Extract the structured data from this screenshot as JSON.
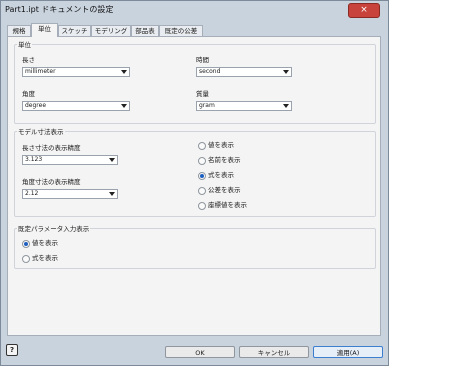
{
  "window": {
    "title": "Part1.ipt ドキュメントの設定",
    "close": "×"
  },
  "tabs": [
    "規格",
    "単位",
    "スケッチ",
    "モデリング",
    "部品表",
    "既定の公差"
  ],
  "units": {
    "legend": "単位",
    "length_label": "長さ",
    "length_value": "millimeter",
    "time_label": "時間",
    "time_value": "second",
    "angle_label": "角度",
    "angle_value": "degree",
    "mass_label": "質量",
    "mass_value": "gram"
  },
  "model_dim": {
    "legend": "モデル寸法表示",
    "linear_precision_label": "長さ寸法の表示精度",
    "linear_precision_value": "3.123",
    "angular_precision_label": "角度寸法の表示精度",
    "angular_precision_value": "2.12",
    "options": [
      {
        "label": "値を表示",
        "checked": false
      },
      {
        "label": "名前を表示",
        "checked": false
      },
      {
        "label": "式を表示",
        "checked": true
      },
      {
        "label": "公差を表示",
        "checked": false
      },
      {
        "label": "座標値を表示",
        "checked": false
      }
    ]
  },
  "param_input": {
    "legend": "既定パラメータ入力表示",
    "options": [
      {
        "label": "値を表示",
        "checked": true
      },
      {
        "label": "式を表示",
        "checked": false
      }
    ]
  },
  "buttons": {
    "ok": "OK",
    "cancel": "キャンセル",
    "apply": "適用(A)"
  },
  "help": "?"
}
